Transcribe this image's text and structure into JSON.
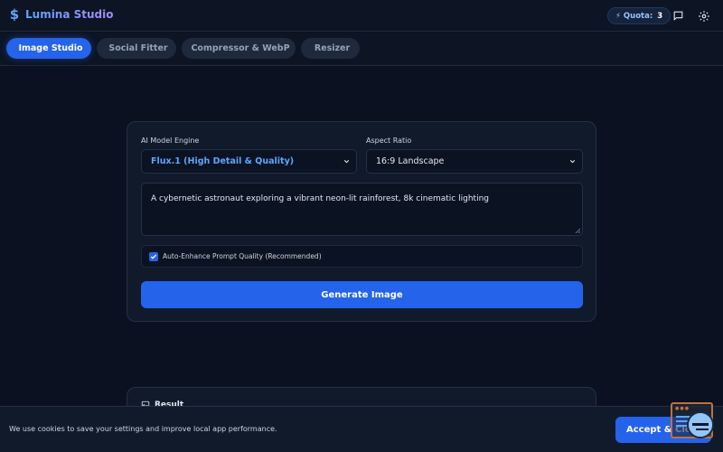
{
  "app": {
    "title": "Lumina Studio",
    "brand_icon": "dollar-icon",
    "brand_gradient": [
      "#60a5fa",
      "#a78bfa"
    ]
  },
  "header": {
    "quota_label": "⚡ Quota:",
    "quota_value": "3",
    "icons": [
      "chat-icon",
      "gear-icon"
    ]
  },
  "tabs": [
    {
      "label": "Image Studio",
      "glyph": "",
      "active": true
    },
    {
      "label": "Social Fitter",
      "glyph": "",
      "active": false
    },
    {
      "label": "Compressor & WebP",
      "glyph": "",
      "active": false
    },
    {
      "label": "Resizer",
      "glyph": "",
      "active": false
    }
  ],
  "form": {
    "model_label": "AI Model Engine",
    "model_value": "Flux.1 (High Detail & Quality)",
    "aspect_label": "Aspect Ratio",
    "aspect_value": "16:9 Landscape",
    "prompt_value": "A cybernetic astronaut exploring a vibrant neon-lit rainforest, 8k cinematic lighting",
    "enhance_checked": true,
    "enhance_label": "Auto-Enhance Prompt Quality (Recommended)",
    "generate_label": "Generate Image"
  },
  "result": {
    "title": "Result"
  },
  "cookie": {
    "text": "We use cookies to save your settings and improve local app performance.",
    "accept_label": "Accept & Close"
  },
  "colors": {
    "accent": "#2563eb",
    "background": "#0b1120",
    "card": "#111a2b",
    "model_text": "#60a5fa"
  }
}
